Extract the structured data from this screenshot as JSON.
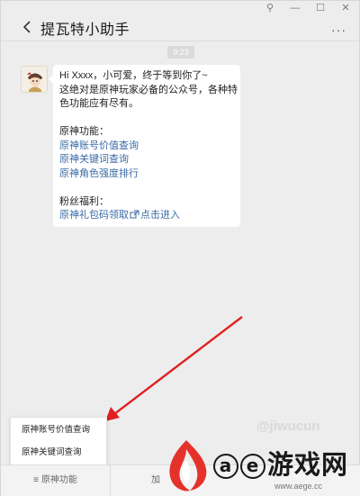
{
  "window": {
    "controls": [
      "⚲",
      "—",
      "☐",
      "✕"
    ]
  },
  "header": {
    "title": "提瓦特小助手",
    "more": "···"
  },
  "chat": {
    "timestamp": "9:23",
    "message": {
      "line1": "Hi Xxxx，小可爱，终于等到你了~",
      "line2": "这绝对是原神玩家必备的公众号，各种特",
      "line3": "色功能应有尽有。",
      "section1_title": "原神功能：",
      "links1": [
        "原神账号价值查询",
        "原神关键词查询",
        "原神角色强度排行"
      ],
      "section2_title": "粉丝福利：",
      "gift_link_a": "原神礼包码领取",
      "gift_link_b": "点击进入"
    }
  },
  "popup_menu": {
    "items": [
      "原神账号价值查询",
      "原神关键词查询"
    ]
  },
  "bottom_menu": {
    "tab1": "原神功能",
    "tab2": "加"
  },
  "watermark": {
    "text": "@jiwucun"
  },
  "site_logo": {
    "a": "a",
    "e": "e",
    "text": "游戏网",
    "sub": "www.aege.cc"
  },
  "colors": {
    "link": "#3a6ba5",
    "arrow": "#e02020",
    "flame": "#e4322b"
  }
}
